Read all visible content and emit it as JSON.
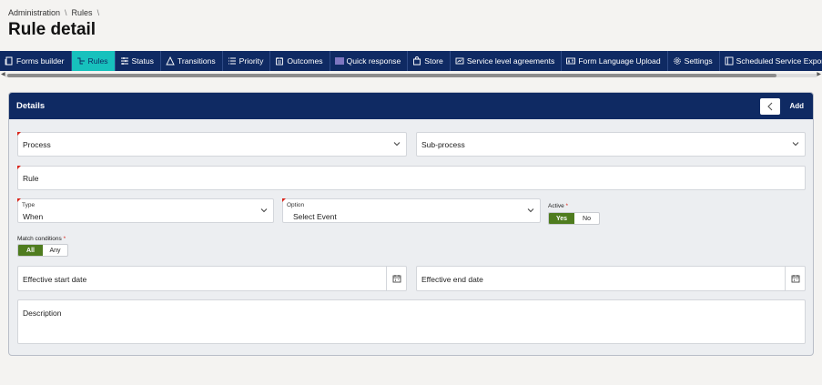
{
  "breadcrumb": {
    "items": [
      "Administration",
      "Rules"
    ],
    "separator": "\\"
  },
  "page": {
    "title": "Rule detail"
  },
  "tabs": [
    {
      "label": "Forms builder",
      "icon": "forms-icon",
      "active": false
    },
    {
      "label": "Rules",
      "icon": "rules-icon",
      "active": true
    },
    {
      "label": "Status",
      "icon": "status-icon",
      "active": false
    },
    {
      "label": "Transitions",
      "icon": "transitions-icon",
      "active": false
    },
    {
      "label": "Priority",
      "icon": "priority-icon",
      "active": false
    },
    {
      "label": "Outcomes",
      "icon": "outcomes-icon",
      "active": false
    },
    {
      "label": "Quick response",
      "icon": "quick-response-icon",
      "active": false
    },
    {
      "label": "Store",
      "icon": "store-icon",
      "active": false
    },
    {
      "label": "Service level agreements",
      "icon": "sla-icon",
      "active": false
    },
    {
      "label": "Form Language Upload",
      "icon": "language-upload-icon",
      "active": false
    },
    {
      "label": "Settings",
      "icon": "gear-icon",
      "active": false
    },
    {
      "label": "Scheduled Service Export",
      "icon": "export-icon",
      "active": false
    }
  ],
  "details": {
    "title": "Details",
    "add_label": "Add",
    "process_placeholder": "Process",
    "subprocess_placeholder": "Sub-process",
    "rule_placeholder": "Rule",
    "type_label": "Type",
    "type_value": "When",
    "option_label": "Option",
    "option_value": "Select Event",
    "active_label": "Active",
    "active_required": "*",
    "active_yes": "Yes",
    "active_no": "No",
    "match_label": "Match conditions",
    "match_required": "*",
    "match_all": "All",
    "match_any": "Any",
    "start_date_placeholder": "Effective start date",
    "end_date_placeholder": "Effective end date",
    "description_placeholder": "Description"
  },
  "colors": {
    "nav": "#0f2a63",
    "active_tab": "#17c1bd",
    "toggle_on": "#4f7c1f",
    "required": "#d9261c"
  }
}
